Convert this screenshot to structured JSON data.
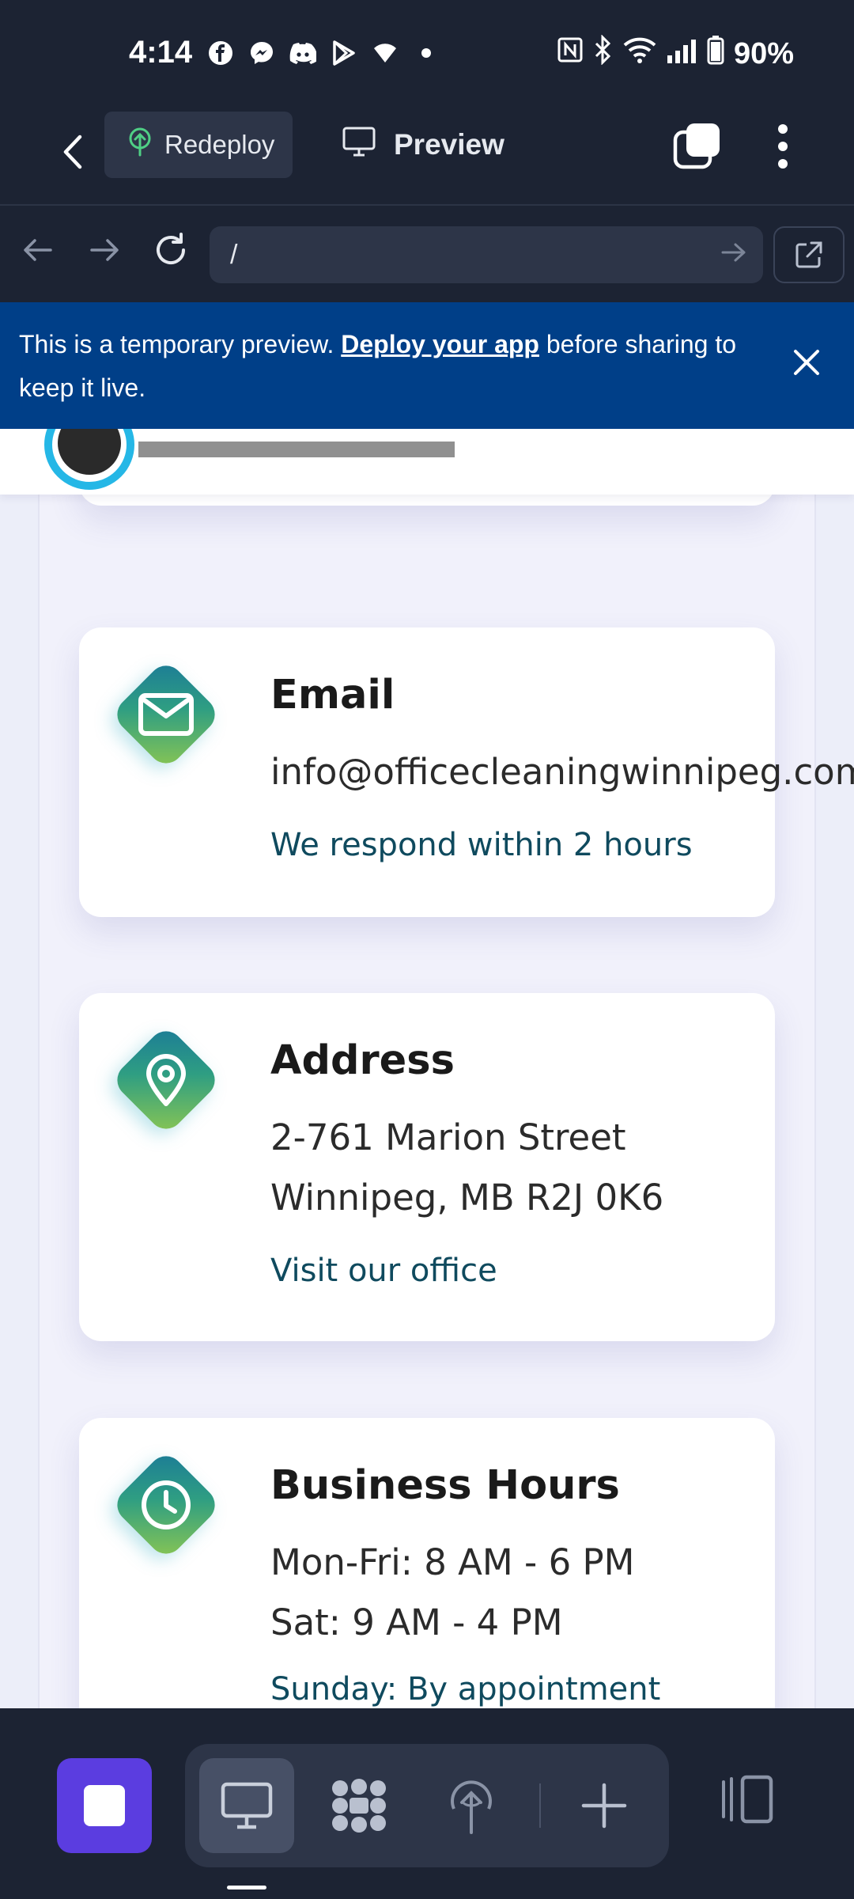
{
  "status_bar": {
    "time": "4:14",
    "battery": "90%",
    "notification_icons": [
      "facebook-icon",
      "messenger-icon",
      "discord-icon",
      "play-store-icon",
      "vpn-icon",
      "dot-icon"
    ],
    "system_icons": [
      "nfc-icon",
      "bluetooth-icon",
      "wifi-icon",
      "signal-icon",
      "battery-icon"
    ]
  },
  "appbar": {
    "redeploy_label": "Redeploy",
    "preview_label": "Preview"
  },
  "browser": {
    "url": "/"
  },
  "banner": {
    "text_before": "This is a temporary preview. ",
    "link": "Deploy your app",
    "text_after": " before sharing to keep it live."
  },
  "cards": {
    "email": {
      "title": "Email",
      "value": "info@officecleaningwinnipeg.com",
      "note": "We respond within 2 hours"
    },
    "address": {
      "title": "Address",
      "line1": "2-761 Marion Street",
      "line2": "Winnipeg, MB R2J 0K6",
      "link": "Visit our office"
    },
    "hours": {
      "title": "Business Hours",
      "line1": "Mon-Fri: 8 AM - 6 PM",
      "line2": "Sat: 9 AM - 4 PM",
      "line3": "Sunday: By appointment"
    }
  },
  "colors": {
    "app_bg": "#1c2333",
    "banner_bg": "#003f88",
    "accent_purple": "#5b3de0",
    "link_teal": "#0f4a5e",
    "icon_gradient": [
      "#1a7a98",
      "#8cc751"
    ]
  }
}
